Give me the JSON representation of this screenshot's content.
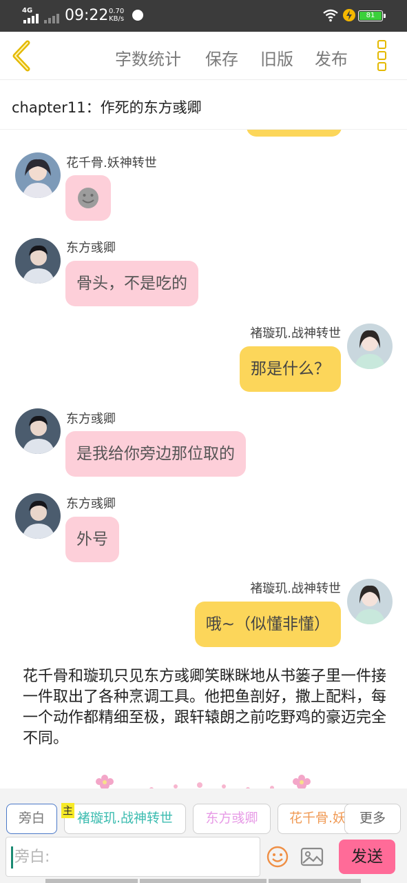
{
  "status_bar": {
    "network": "4G",
    "time": "09:22",
    "speed_value": "0.70",
    "speed_unit": "KB/s",
    "battery": "81"
  },
  "toolbar": {
    "word_count": "字数统计",
    "save": "保存",
    "old_version": "旧版",
    "publish": "发布"
  },
  "chapter": {
    "title": "chapter11：作死的东方彧卿"
  },
  "messages": [
    {
      "sender": "花千骨.妖神转世",
      "text": "",
      "side": "left",
      "color": "pink",
      "kind": "emoji"
    },
    {
      "sender": "东方彧卿",
      "text": "骨头，不是吃的",
      "side": "left",
      "color": "pink"
    },
    {
      "sender": "褚璇玑.战神转世",
      "text": "那是什么？",
      "side": "right",
      "color": "yellow"
    },
    {
      "sender": "东方彧卿",
      "text": "是我给你旁边那位取的",
      "side": "left",
      "color": "pink"
    },
    {
      "sender": "东方彧卿",
      "text": "外号",
      "side": "left",
      "color": "pink"
    },
    {
      "sender": "褚璇玑.战神转世",
      "text": "哦~（似懂非懂）",
      "side": "right",
      "color": "yellow"
    }
  ],
  "narration": "花千骨和璇玑只见东方彧卿笑眯眯地从书篓子里一件接一件取出了各种烹调工具。他把鱼剖好，撒上配料，每一个动作都精细至极，跟轩辕朗之前吃野鸡的豪迈完全不同。",
  "roles": {
    "narrator": "旁白",
    "main_tag": "主",
    "items": [
      {
        "name": "褚璇玑.战神转世",
        "color": "#3cbcb0"
      },
      {
        "name": "东方彧卿",
        "color": "#e79ae6"
      },
      {
        "name": "花千骨.妖神转世",
        "color": "#f09a55"
      }
    ],
    "more": "更多"
  },
  "composer": {
    "placeholder": "旁白:",
    "emoji_icon": "smiley-icon",
    "image_icon": "image-icon",
    "send": "发送"
  },
  "colors": {
    "accent_yellow": "#e4b900",
    "bubble_pink": "#fdcfd9",
    "bubble_yellow": "#fcd65a",
    "send_pink": "#ff6b98"
  }
}
